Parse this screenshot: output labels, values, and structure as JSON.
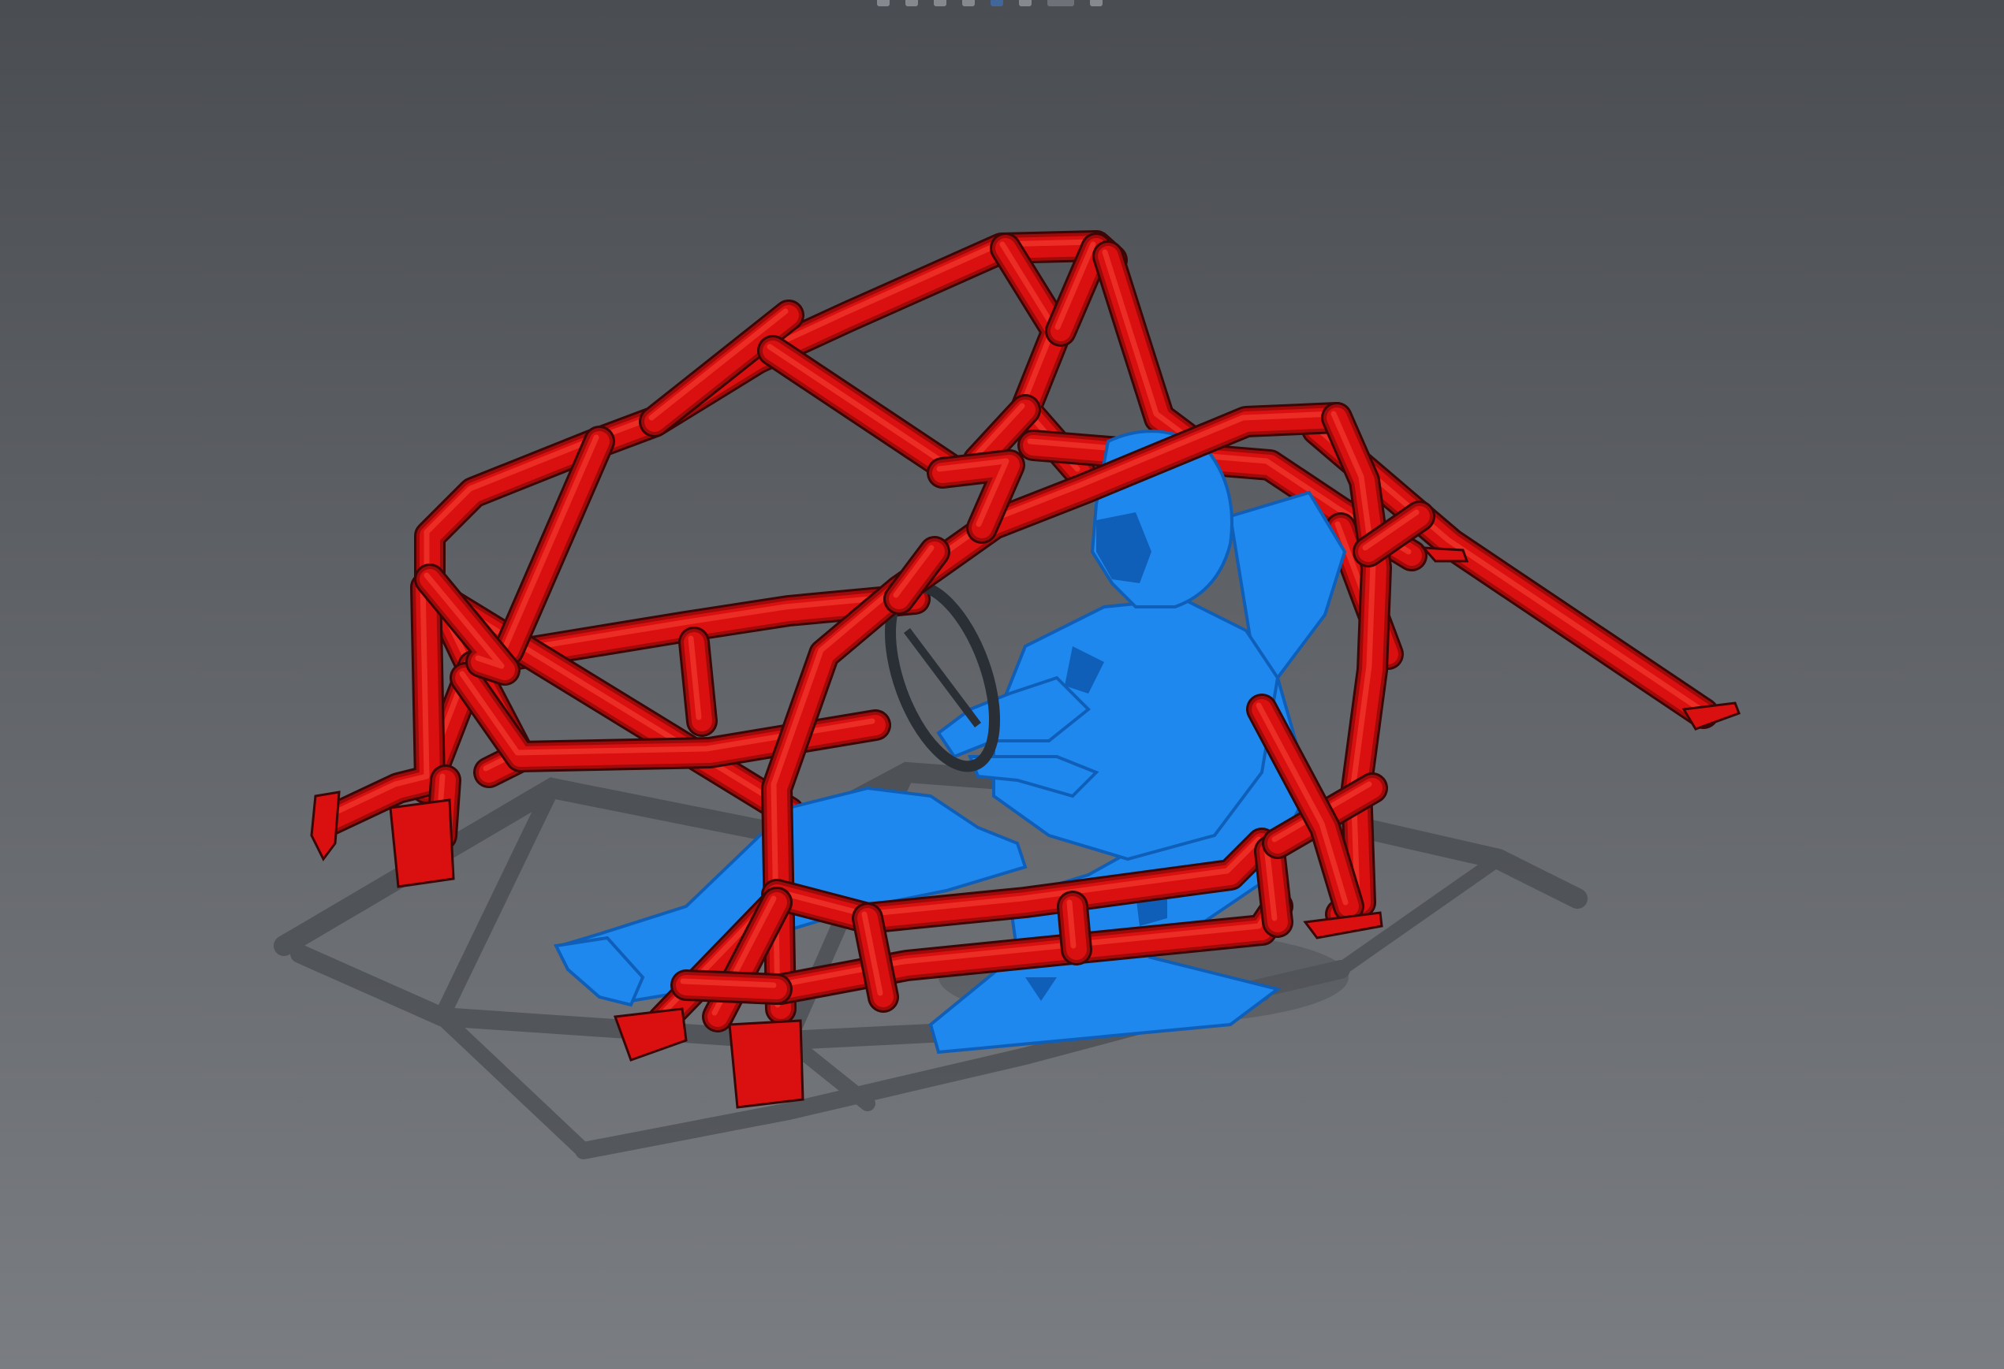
{
  "viewport": {
    "background_top": "#4a4d52",
    "background_bottom": "#7a7d82"
  },
  "colors": {
    "cage": "#d9100f",
    "cage_shade": "#9e0a0a",
    "cage_highlight": "#f23a2f",
    "driver": "#1e88ee",
    "driver_shade": "#0f5fb8",
    "outline": "#3a0606",
    "shadow": "#3c3f44"
  },
  "toolbar": {
    "icons": [
      "rotate-icon",
      "pan-icon",
      "zoom-icon",
      "section-view-icon",
      "view-orientation-icon",
      "display-style-icon",
      "appearance-icon",
      "scene-icon"
    ]
  },
  "scene": {
    "objects": [
      "roll-cage",
      "driver-model",
      "steering-wheel",
      "racing-seat"
    ]
  }
}
